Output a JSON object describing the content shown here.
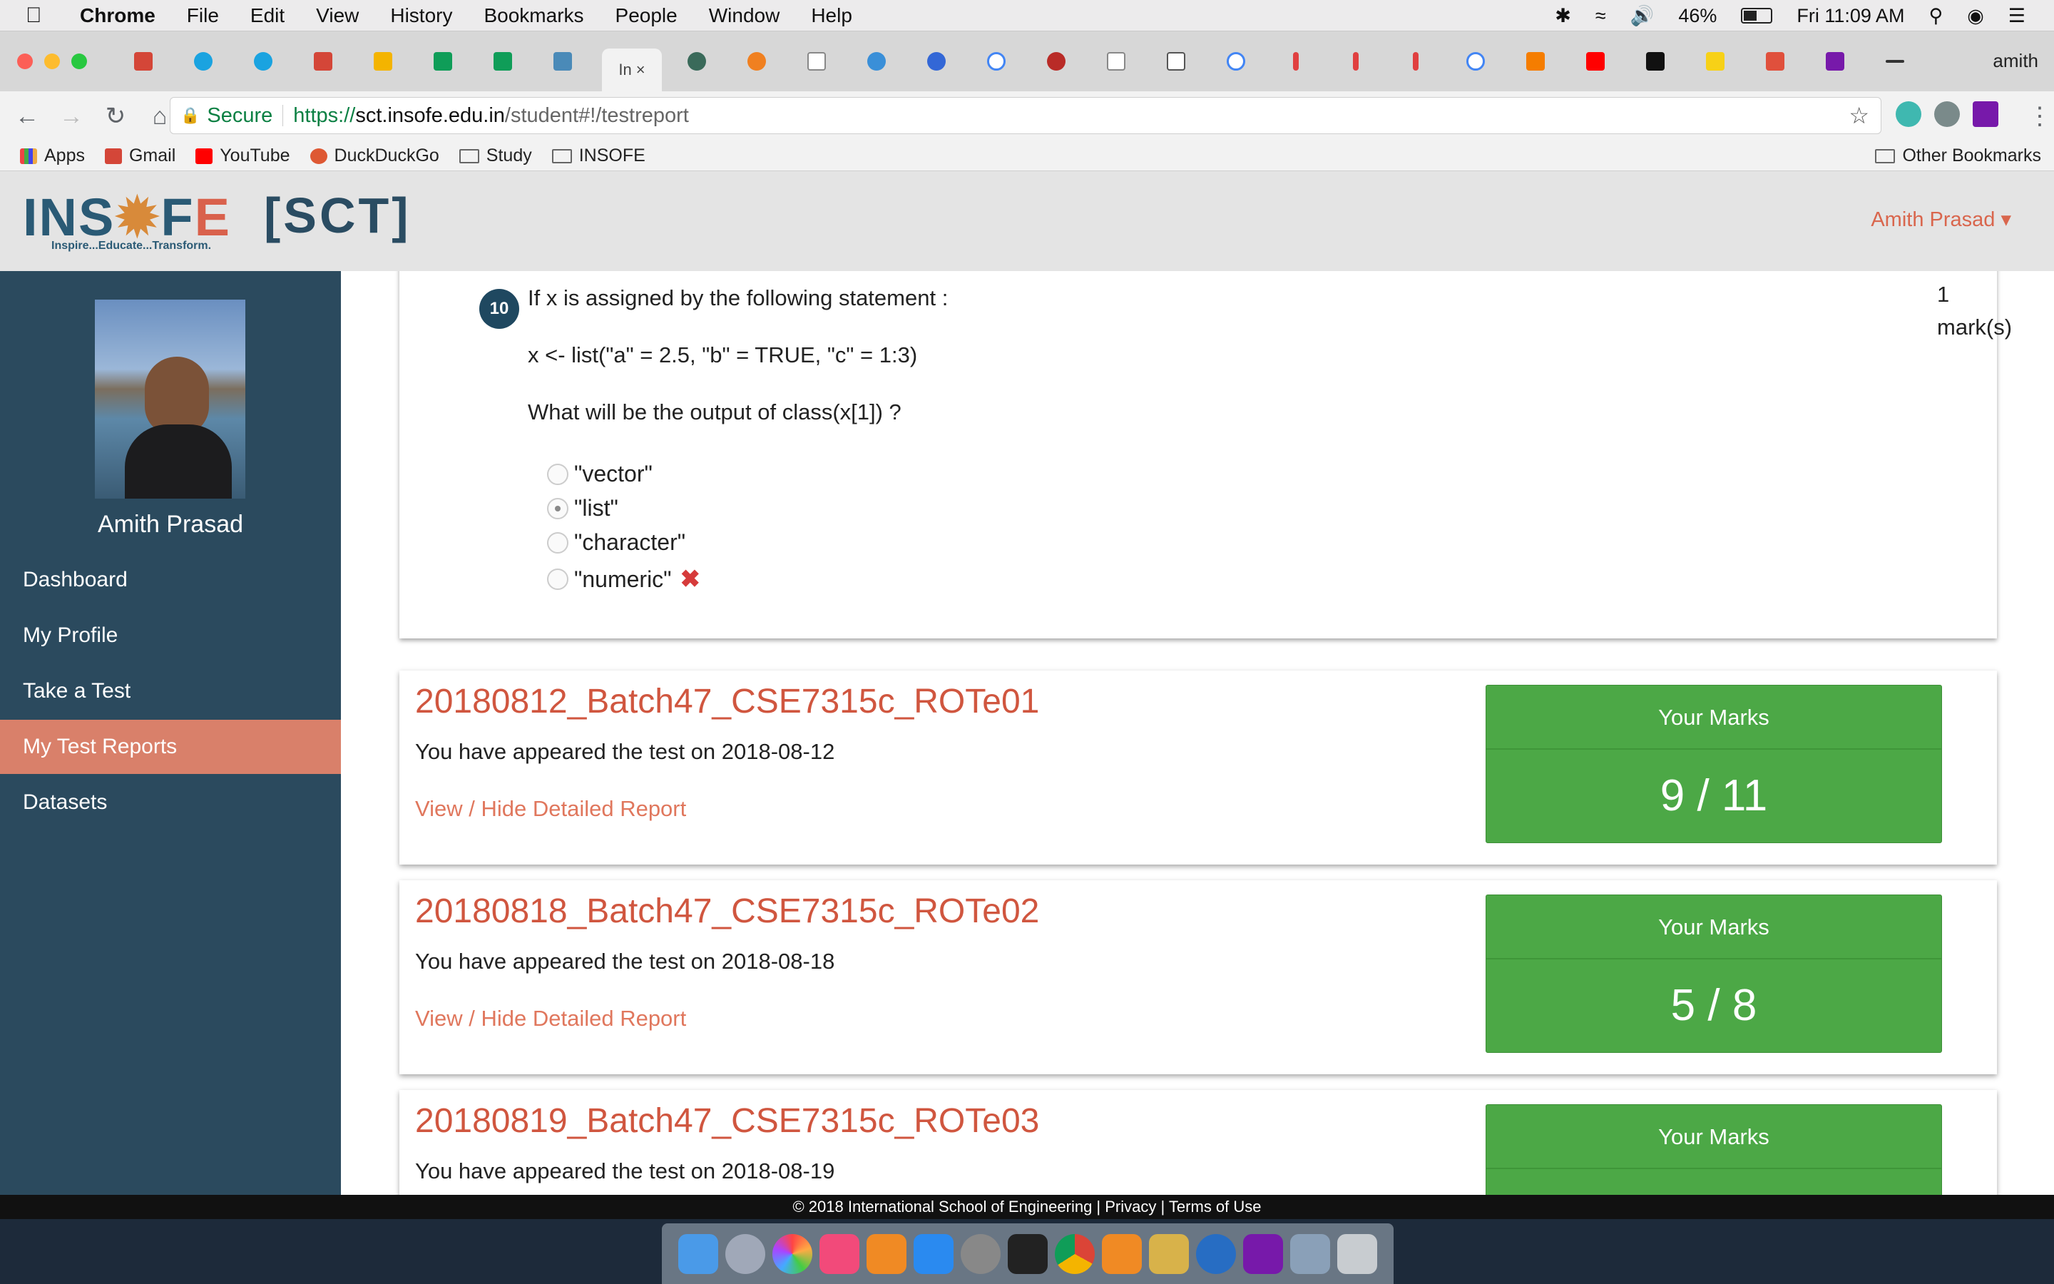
{
  "menubar": {
    "app_name": "Chrome",
    "items": [
      "File",
      "Edit",
      "View",
      "History",
      "Bookmarks",
      "People",
      "Window",
      "Help"
    ],
    "battery": "46%",
    "clock": "Fri 11:09 AM"
  },
  "browser": {
    "active_tab_label": "In ×",
    "profile_name": "amith",
    "secure_label": "Secure",
    "url_scheme": "https://",
    "url_host": "sct.insofe.edu.in",
    "url_path": "/student#!/testreport",
    "bookmarks": [
      "Apps",
      "Gmail",
      "YouTube",
      "DuckDuckGo",
      "Study",
      "INSOFE"
    ],
    "other_bookmarks": "Other Bookmarks"
  },
  "site": {
    "logo_text_1": "INS",
    "logo_text_2": "F",
    "logo_text_3": "E",
    "tagline": "Inspire...Educate...Transform.",
    "product": "[SCT]",
    "user_menu": "Amith Prasad ▾"
  },
  "sidebar": {
    "name": "Amith Prasad",
    "items": [
      {
        "label": "Dashboard"
      },
      {
        "label": "My Profile"
      },
      {
        "label": "Take a Test"
      },
      {
        "label": "My Test Reports"
      },
      {
        "label": "Datasets"
      }
    ]
  },
  "question": {
    "number": "10",
    "text": "If x is assigned by the following statement :",
    "code": "x <- list(\"a\" = 2.5, \"b\" = TRUE, \"c\" = 1:3)",
    "prompt": "What will be the output of class(x[1]) ?",
    "marks_value": "1",
    "marks_unit": "mark(s)",
    "options": [
      "\"vector\"",
      "\"list\"",
      "\"character\"",
      "\"numeric\""
    ],
    "selected_index": 1,
    "wrong_mark": "✖"
  },
  "reports": [
    {
      "title": "20180812_Batch47_CSE7315c_ROTe01",
      "appeared": "You have appeared the test on 2018-08-12",
      "link": "View / Hide Detailed Report",
      "marks_label": "Your Marks",
      "marks": "9 / 11"
    },
    {
      "title": "20180818_Batch47_CSE7315c_ROTe02",
      "appeared": "You have appeared the test on 2018-08-18",
      "link": "View / Hide Detailed Report",
      "marks_label": "Your Marks",
      "marks": "5 / 8"
    },
    {
      "title": "20180819_Batch47_CSE7315c_ROTe03",
      "appeared": "You have appeared the test on 2018-08-19",
      "link": "View / Hide Detailed Report",
      "marks_label": "Your Marks",
      "marks": ""
    }
  ],
  "footer": {
    "copyright": "© 2018 International School of Engineering | Privacy | Terms of Use"
  },
  "colors": {
    "sidebar_bg": "#2b4a5e",
    "accent": "#d0563f",
    "marks_green": "#4ca846",
    "active_nav": "#d9806a"
  }
}
